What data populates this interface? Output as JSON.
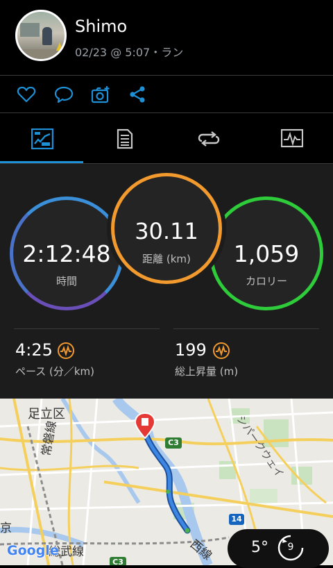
{
  "header": {
    "username": "Shimo",
    "meta": "02/23 @ 5:07・ラン"
  },
  "social": {
    "icons": [
      "heart-icon",
      "comment-icon",
      "add-photo-icon",
      "share-icon"
    ]
  },
  "tabs": {
    "icons": [
      "summary-icon",
      "details-icon",
      "laps-icon",
      "charts-icon"
    ],
    "active": 0
  },
  "stats": {
    "time": {
      "value": "2:12:48",
      "label": "時間"
    },
    "distance": {
      "value": "30.11",
      "label": "距離 (km)"
    },
    "calories": {
      "value": "1,059",
      "label": "カロリー"
    },
    "pace": {
      "value": "4:25",
      "label": "ペース (分／km)"
    },
    "elevation": {
      "value": "199",
      "label": "総上昇量 (m)"
    }
  },
  "colors": {
    "accent": "#1e90d6",
    "time_ring_top": "#3b8fd8",
    "time_ring_bottom": "#6a4fb8",
    "distance_ring": "#f29a2e",
    "calories_ring": "#2ecc3a",
    "stat_icon": "#f29a2e"
  },
  "map": {
    "labels": {
      "adachi": "足立区",
      "joban": "常磐線",
      "sobu": "総武線",
      "c3_top": "C3",
      "c3_bottom": "C3",
      "route14": "14",
      "nishi": "西線",
      "parkway": "シパークウェイ",
      "google": "Google",
      "left_edge": "京"
    }
  },
  "weather": {
    "temperature": "5°",
    "wind": "9"
  }
}
